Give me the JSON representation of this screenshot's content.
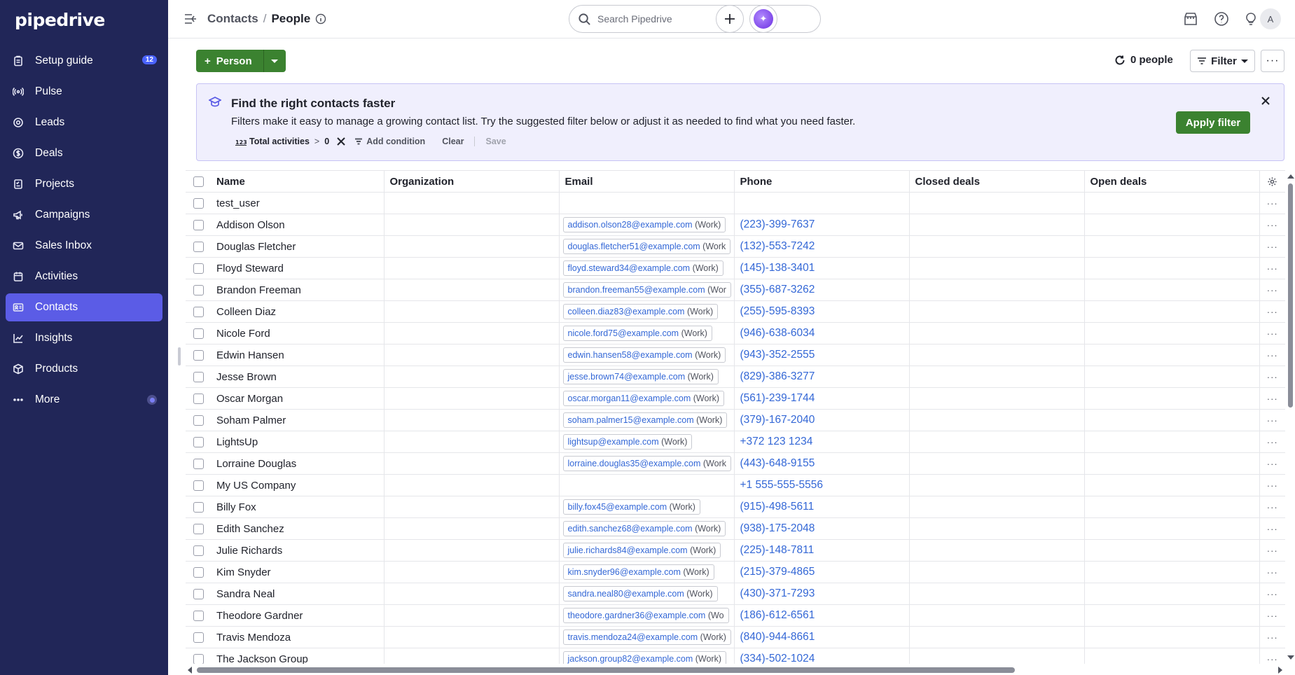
{
  "app": {
    "brand": "pipedrive"
  },
  "sidebar": {
    "items": [
      {
        "label": "Setup guide",
        "icon": "clipboard-icon",
        "badge": "12",
        "active": false
      },
      {
        "label": "Pulse",
        "icon": "pulse-icon",
        "active": false
      },
      {
        "label": "Leads",
        "icon": "target-icon",
        "active": false
      },
      {
        "label": "Deals",
        "icon": "dollar-icon",
        "active": false
      },
      {
        "label": "Projects",
        "icon": "checklist-icon",
        "active": false
      },
      {
        "label": "Campaigns",
        "icon": "megaphone-icon",
        "active": false
      },
      {
        "label": "Sales Inbox",
        "icon": "mail-icon",
        "active": false
      },
      {
        "label": "Activities",
        "icon": "calendar-icon",
        "active": false
      },
      {
        "label": "Contacts",
        "icon": "contact-card-icon",
        "active": true
      },
      {
        "label": "Insights",
        "icon": "chart-icon",
        "active": false
      },
      {
        "label": "Products",
        "icon": "box-icon",
        "active": false
      },
      {
        "label": "More",
        "icon": "more-dots-icon",
        "active": false
      }
    ]
  },
  "header": {
    "breadcrumb_parent": "Contacts",
    "breadcrumb_separator": "/",
    "breadcrumb_current": "People",
    "search_placeholder": "Search Pipedrive",
    "avatar_initial": "A"
  },
  "toolbar": {
    "add_label": "Person",
    "people_count": "0 people",
    "filter_label": "Filter",
    "more_label": "···"
  },
  "banner": {
    "title": "Find the right contacts faster",
    "text": "Filters make it easy to manage a growing contact list. Try the suggested filter below or adjust it as needed to find what you need faster.",
    "apply_label": "Apply filter",
    "condition_field": "Total activities",
    "condition_operator": ">",
    "condition_value": "0",
    "add_condition_label": "Add condition",
    "clear_label": "Clear",
    "save_label": "Save"
  },
  "table": {
    "columns": [
      "Name",
      "Organization",
      "Email",
      "Phone",
      "Closed deals",
      "Open deals"
    ],
    "rows": [
      {
        "name": "test_user",
        "organization": "",
        "email": "",
        "email_type": "",
        "phone": "",
        "closed_deals": "",
        "open_deals": ""
      },
      {
        "name": "Addison Olson",
        "organization": "",
        "email": "addison.olson28@example.com",
        "email_type": "(Work)",
        "phone": "(223)-399-7637",
        "closed_deals": "",
        "open_deals": ""
      },
      {
        "name": "Douglas Fletcher",
        "organization": "",
        "email": "douglas.fletcher51@example.com",
        "email_type": "(Work",
        "phone": "(132)-553-7242",
        "closed_deals": "",
        "open_deals": ""
      },
      {
        "name": "Floyd Steward",
        "organization": "",
        "email": "floyd.steward34@example.com",
        "email_type": "(Work)",
        "phone": "(145)-138-3401",
        "closed_deals": "",
        "open_deals": ""
      },
      {
        "name": "Brandon Freeman",
        "organization": "",
        "email": "brandon.freeman55@example.com",
        "email_type": "(Wor",
        "phone": "(355)-687-3262",
        "closed_deals": "",
        "open_deals": ""
      },
      {
        "name": "Colleen Diaz",
        "organization": "",
        "email": "colleen.diaz83@example.com",
        "email_type": "(Work)",
        "phone": "(255)-595-8393",
        "closed_deals": "",
        "open_deals": ""
      },
      {
        "name": "Nicole Ford",
        "organization": "",
        "email": "nicole.ford75@example.com",
        "email_type": "(Work)",
        "phone": "(946)-638-6034",
        "closed_deals": "",
        "open_deals": ""
      },
      {
        "name": "Edwin Hansen",
        "organization": "",
        "email": "edwin.hansen58@example.com",
        "email_type": "(Work)",
        "phone": "(943)-352-2555",
        "closed_deals": "",
        "open_deals": ""
      },
      {
        "name": "Jesse Brown",
        "organization": "",
        "email": "jesse.brown74@example.com",
        "email_type": "(Work)",
        "phone": "(829)-386-3277",
        "closed_deals": "",
        "open_deals": ""
      },
      {
        "name": "Oscar Morgan",
        "organization": "",
        "email": "oscar.morgan11@example.com",
        "email_type": "(Work)",
        "phone": "(561)-239-1744",
        "closed_deals": "",
        "open_deals": ""
      },
      {
        "name": "Soham Palmer",
        "organization": "",
        "email": "soham.palmer15@example.com",
        "email_type": "(Work)",
        "phone": "(379)-167-2040",
        "closed_deals": "",
        "open_deals": ""
      },
      {
        "name": "LightsUp",
        "organization": "",
        "email": "lightsup@example.com",
        "email_type": "(Work)",
        "phone": "+372 123 1234",
        "closed_deals": "",
        "open_deals": ""
      },
      {
        "name": "Lorraine Douglas",
        "organization": "",
        "email": "lorraine.douglas35@example.com",
        "email_type": "(Work",
        "phone": "(443)-648-9155",
        "closed_deals": "",
        "open_deals": ""
      },
      {
        "name": "My US Company",
        "organization": "",
        "email": "",
        "email_type": "",
        "phone": "+1 555-555-5556",
        "closed_deals": "",
        "open_deals": ""
      },
      {
        "name": "Billy Fox",
        "organization": "",
        "email": "billy.fox45@example.com",
        "email_type": "(Work)",
        "phone": "(915)-498-5611",
        "closed_deals": "",
        "open_deals": ""
      },
      {
        "name": "Edith Sanchez",
        "organization": "",
        "email": "edith.sanchez68@example.com",
        "email_type": "(Work)",
        "phone": "(938)-175-2048",
        "closed_deals": "",
        "open_deals": ""
      },
      {
        "name": "Julie Richards",
        "organization": "",
        "email": "julie.richards84@example.com",
        "email_type": "(Work)",
        "phone": "(225)-148-7811",
        "closed_deals": "",
        "open_deals": ""
      },
      {
        "name": "Kim Snyder",
        "organization": "",
        "email": "kim.snyder96@example.com",
        "email_type": "(Work)",
        "phone": "(215)-379-4865",
        "closed_deals": "",
        "open_deals": ""
      },
      {
        "name": "Sandra Neal",
        "organization": "",
        "email": "sandra.neal80@example.com",
        "email_type": "(Work)",
        "phone": "(430)-371-7293",
        "closed_deals": "",
        "open_deals": ""
      },
      {
        "name": "Theodore Gardner",
        "organization": "",
        "email": "theodore.gardner36@example.com",
        "email_type": "(Wo",
        "phone": "(186)-612-6561",
        "closed_deals": "",
        "open_deals": ""
      },
      {
        "name": "Travis Mendoza",
        "organization": "",
        "email": "travis.mendoza24@example.com",
        "email_type": "(Work)",
        "phone": "(840)-944-8661",
        "closed_deals": "",
        "open_deals": ""
      },
      {
        "name": "The Jackson Group",
        "organization": "",
        "email": "jackson.group82@example.com",
        "email_type": "(Work)",
        "phone": "(334)-502-1024",
        "closed_deals": "",
        "open_deals": ""
      }
    ],
    "row_menu_label": "···"
  },
  "colors": {
    "sidebar_bg": "#212658",
    "sidebar_active": "#5b5ce6",
    "primary_green": "#3b8230",
    "link_blue": "#3367d6",
    "banner_bg": "#f0effd"
  }
}
